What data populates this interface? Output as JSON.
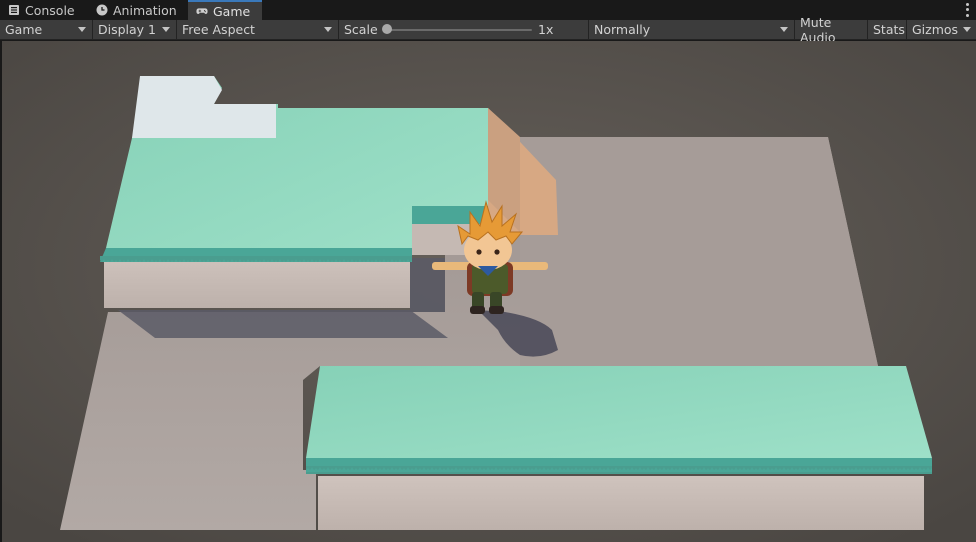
{
  "tabs": [
    {
      "label": "Console",
      "icon": "console-icon"
    },
    {
      "label": "Animation",
      "icon": "animation-clock-icon"
    },
    {
      "label": "Game",
      "icon": "gamepad-icon",
      "active": true
    }
  ],
  "toolbar": {
    "view_mode": "Game",
    "display": "Display 1",
    "aspect": "Free Aspect",
    "scale_label": "Scale",
    "scale_value": "1x",
    "play_focus": "Normally",
    "mute_audio": "Mute Audio",
    "stats": "Stats",
    "gizmos": "Gizmos"
  },
  "colors": {
    "accent": "#3a79bb",
    "platform_top": "#8fd6bd",
    "platform_edge": "#4aa697",
    "floor": "#a59b97",
    "ramp": "#d7a883"
  }
}
